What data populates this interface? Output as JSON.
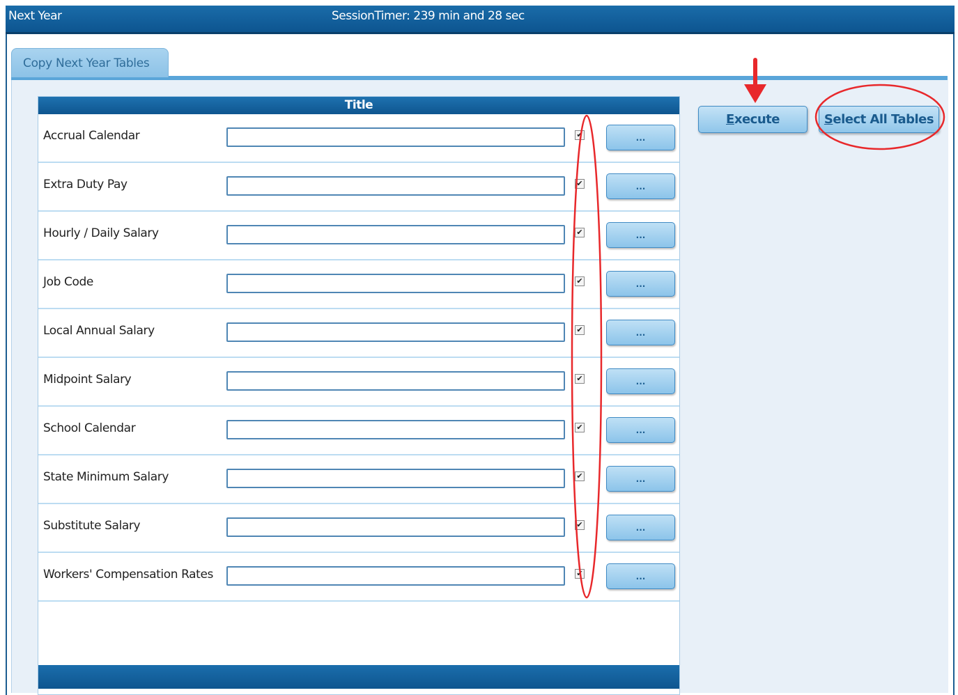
{
  "window": {
    "title": "Next Year",
    "session_timer": "SessionTimer: 239 min and 28 sec"
  },
  "tabs": [
    {
      "label": "Copy Next Year Tables",
      "active": true
    }
  ],
  "grid": {
    "header": "Title",
    "rows": [
      {
        "label": "Accrual Calendar",
        "value": "",
        "checked": true,
        "button_label": "..."
      },
      {
        "label": "Extra Duty Pay",
        "value": "",
        "checked": true,
        "button_label": "..."
      },
      {
        "label": "Hourly / Daily Salary",
        "value": "",
        "checked": true,
        "button_label": "..."
      },
      {
        "label": "Job Code",
        "value": "",
        "checked": true,
        "button_label": "..."
      },
      {
        "label": "Local Annual Salary",
        "value": "",
        "checked": true,
        "button_label": "..."
      },
      {
        "label": "Midpoint Salary",
        "value": "",
        "checked": true,
        "button_label": "..."
      },
      {
        "label": "School Calendar",
        "value": "",
        "checked": true,
        "button_label": "..."
      },
      {
        "label": "State Minimum Salary",
        "value": "",
        "checked": true,
        "button_label": "..."
      },
      {
        "label": "Substitute Salary",
        "value": "",
        "checked": true,
        "button_label": "..."
      },
      {
        "label": "Workers' Compensation Rates",
        "value": "",
        "checked": true,
        "button_label": "..."
      }
    ]
  },
  "actions": {
    "execute": {
      "accel": "E",
      "rest": "xecute"
    },
    "select_all": {
      "accel": "S",
      "rest": "elect All Tables"
    }
  },
  "annotations": {
    "highlight_color": "#e8282b",
    "items": [
      "checkbox-column-highlight",
      "execute-arrow",
      "select-all-highlight"
    ]
  },
  "colors": {
    "titlebar": "#0d5590",
    "tab": "#8cc2e7",
    "button": "#8cc4ea"
  }
}
